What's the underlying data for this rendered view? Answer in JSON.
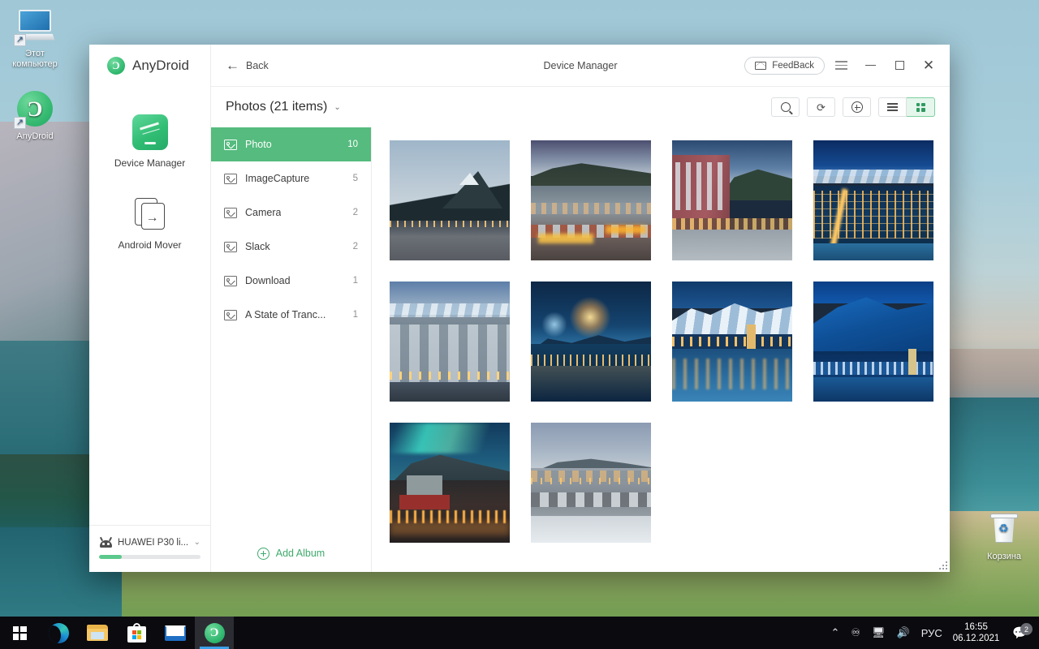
{
  "desktop": {
    "icons": [
      {
        "name": "Этот\nкомпьютер",
        "label_line1": "Этот",
        "label_line2": "компьютер",
        "icon": "monitor-icon"
      },
      {
        "name": "AnyDroid",
        "label_line1": "AnyDroid",
        "label_line2": "",
        "icon": "anydroid-icon"
      },
      {
        "name": "Корзина",
        "label_line1": "Корзина",
        "label_line2": "",
        "icon": "recycle-bin-icon"
      }
    ]
  },
  "taskbar": {
    "items": [
      {
        "label": "Start",
        "icon": "windows-logo-icon",
        "active": false
      },
      {
        "label": "Microsoft Edge",
        "icon": "edge-icon",
        "active": false
      },
      {
        "label": "File Explorer",
        "icon": "folder-icon",
        "active": false
      },
      {
        "label": "Microsoft Store",
        "icon": "store-icon",
        "active": false
      },
      {
        "label": "Mail",
        "icon": "mail-icon",
        "active": false
      },
      {
        "label": "AnyDroid",
        "icon": "anydroid-icon",
        "active": true
      }
    ],
    "tray": {
      "chevron": "⌃",
      "camera_icon": "camera-privacy-icon",
      "network_icon": "network-icon",
      "volume_icon": "volume-icon",
      "language": "РУС",
      "time": "16:55",
      "date": "06.12.2021",
      "notification_icon": "notification-icon",
      "notification_count": "2"
    }
  },
  "app": {
    "brand": {
      "name": "AnyDroid",
      "mark": "anydroid-logo-icon"
    },
    "rail": {
      "items": [
        {
          "label": "Device Manager",
          "icon": "phone-icon",
          "active": true
        },
        {
          "label": "Android Mover",
          "icon": "transfer-files-icon",
          "active": false
        }
      ]
    },
    "device": {
      "name": "HUAWEI P30 li...",
      "icon": "android-robot-icon",
      "chevron": "⌄",
      "storage_percent": 22
    },
    "titlebar": {
      "back_label": "Back",
      "back_icon": "arrow-left-icon",
      "title": "Device Manager",
      "feedback_label": "FeedBack",
      "feedback_icon": "envelope-icon",
      "menu_icon": "hamburger-menu-icon",
      "minimize_icon": "minimize-icon",
      "maximize_icon": "maximize-icon",
      "close_icon": "close-icon"
    },
    "content": {
      "breadcrumb": "Photos (21 items)",
      "breadcrumb_chevron": "⌄",
      "tools": [
        {
          "name": "search",
          "icon": "search-icon",
          "active": false
        },
        {
          "name": "refresh",
          "icon": "refresh-icon",
          "active": false
        },
        {
          "name": "add",
          "icon": "plus-circle-icon",
          "active": false
        },
        {
          "name": "list-view",
          "icon": "list-view-icon",
          "active": false
        },
        {
          "name": "grid-view",
          "icon": "grid-view-icon",
          "active": true
        }
      ],
      "refresh_glyph": "⟳",
      "albums": [
        {
          "label": "Photo",
          "count": "10",
          "selected": true
        },
        {
          "label": "ImageCapture",
          "count": "5",
          "selected": false
        },
        {
          "label": "Camera",
          "count": "2",
          "selected": false
        },
        {
          "label": "Slack",
          "count": "2",
          "selected": false
        },
        {
          "label": "Download",
          "count": "1",
          "selected": false
        },
        {
          "label": "A State of Tranc...",
          "count": "1",
          "selected": false
        }
      ],
      "add_album_label": "Add Album",
      "add_album_icon": "plus-circle-icon",
      "photos": [
        {
          "alt": "Mountain above dusk harbor town",
          "variant": "t1"
        },
        {
          "alt": "Hillside town with warm street lights",
          "variant": "t2"
        },
        {
          "alt": "Historic brick street at blue hour",
          "variant": "t3"
        },
        {
          "alt": "Aerial night city with mountain range",
          "variant": "t4"
        },
        {
          "alt": "Downtown blocks at dusk with snowy peaks",
          "variant": "t5"
        },
        {
          "alt": "Fireworks over bay and mountains",
          "variant": "t6"
        },
        {
          "alt": "Snow mountains reflected in calm water",
          "variant": "t7"
        },
        {
          "alt": "Deep blue mountain behind waterfront city",
          "variant": "t8"
        },
        {
          "alt": "Aurora over illuminated town",
          "variant": "t9"
        },
        {
          "alt": "Snow covered town at twilight",
          "variant": "t10"
        }
      ]
    },
    "colors": {
      "accent_green": "#55bb7e",
      "accent_green_dark": "#3faa6c",
      "selected_tool_bg": "#e5f6ec"
    }
  }
}
